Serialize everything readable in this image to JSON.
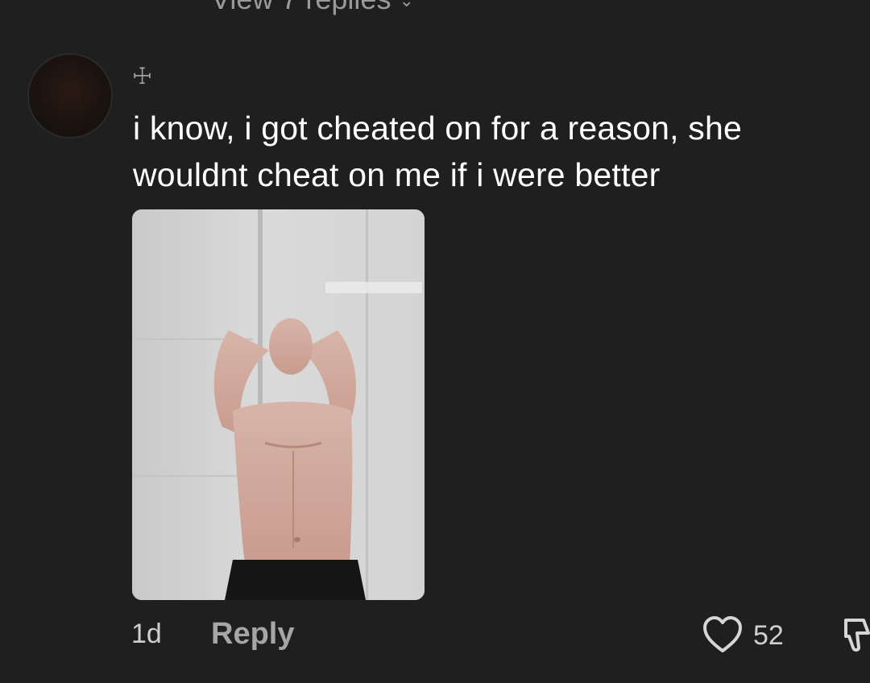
{
  "thread": {
    "view_replies_label": "View 7 replies",
    "view_replies_icon": "chevron-down-icon"
  },
  "comment": {
    "username": "☩",
    "text": "i know, i got cheated on for a reason, she wouldnt cheat on me if i were better",
    "time": "1d",
    "reply_label": "Reply",
    "like_count": "52",
    "like_icon": "heart-icon",
    "dislike_icon": "thumbs-down-icon"
  },
  "colors": {
    "background": "#1f1f1f",
    "text_primary": "#ffffff",
    "text_secondary": "#a6a6a6"
  }
}
